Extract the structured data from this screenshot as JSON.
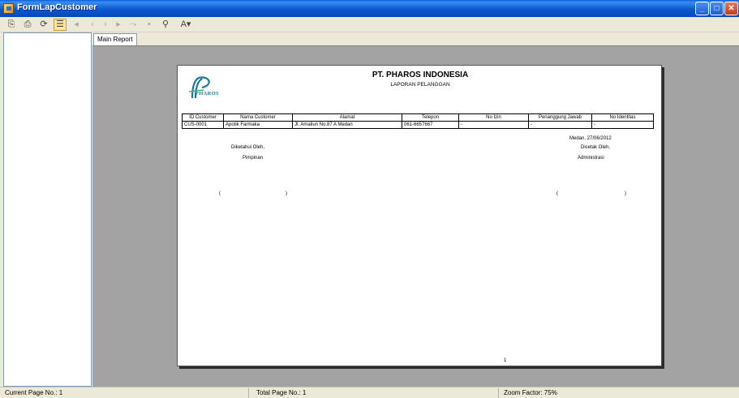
{
  "window": {
    "title": "FormLapCustomer"
  },
  "toolbar": {
    "buttons": [
      {
        "icon": "export-icon",
        "glyph": "⎘"
      },
      {
        "icon": "print-icon",
        "glyph": "⎙"
      },
      {
        "icon": "refresh-icon",
        "glyph": "⟳"
      },
      {
        "icon": "group-tree-icon",
        "glyph": "☰"
      },
      {
        "icon": "first-page-icon",
        "glyph": "⏮"
      },
      {
        "icon": "previous-page-icon",
        "glyph": "◀"
      },
      {
        "icon": "next-page-icon",
        "glyph": "▶"
      },
      {
        "icon": "last-page-icon",
        "glyph": "⏭"
      },
      {
        "icon": "goto-page-icon",
        "glyph": "⤳"
      },
      {
        "icon": "stop-icon",
        "glyph": "■"
      },
      {
        "icon": "search-icon",
        "glyph": "🔍"
      },
      {
        "icon": "zoom-icon",
        "glyph": "A"
      }
    ]
  },
  "tabs": [
    {
      "label": "Main Report"
    }
  ],
  "report": {
    "company": "PT. PHAROS INDONESIA",
    "title": "LAPORAN PELANGGAN",
    "logo_text": "PHAROS",
    "columns": [
      "ID Customer",
      "Nama Customer",
      "Alamat",
      "Telepon",
      "No Izin",
      "Penanggung Jawab",
      "No Identitas"
    ],
    "rows": [
      [
        "CUS-0001",
        "Apotik Farmaka",
        "Jl. Amaliun No.87 A Medan",
        "061-6657667",
        "-",
        "-",
        "-"
      ]
    ],
    "place_date": "Medan,  27/06/2012",
    "left_sig": {
      "label1": "Diketahui Oleh,",
      "label2": "Pimpinan",
      "bracket_open": "(",
      "bracket_close": ")"
    },
    "right_sig": {
      "label1": "Dicetak Oleh,",
      "label2": "Administrasi",
      "bracket_open": "(",
      "bracket_close": ")"
    },
    "page_number": "1"
  },
  "status": {
    "current_page": "Current Page No.: 1",
    "total_page": "Total Page No.: 1",
    "zoom": "Zoom Factor: 75%"
  },
  "colors": {
    "titlebar": "#0a58d0",
    "viewport": "#a3a3a3",
    "logo": "#1a7a9a"
  }
}
